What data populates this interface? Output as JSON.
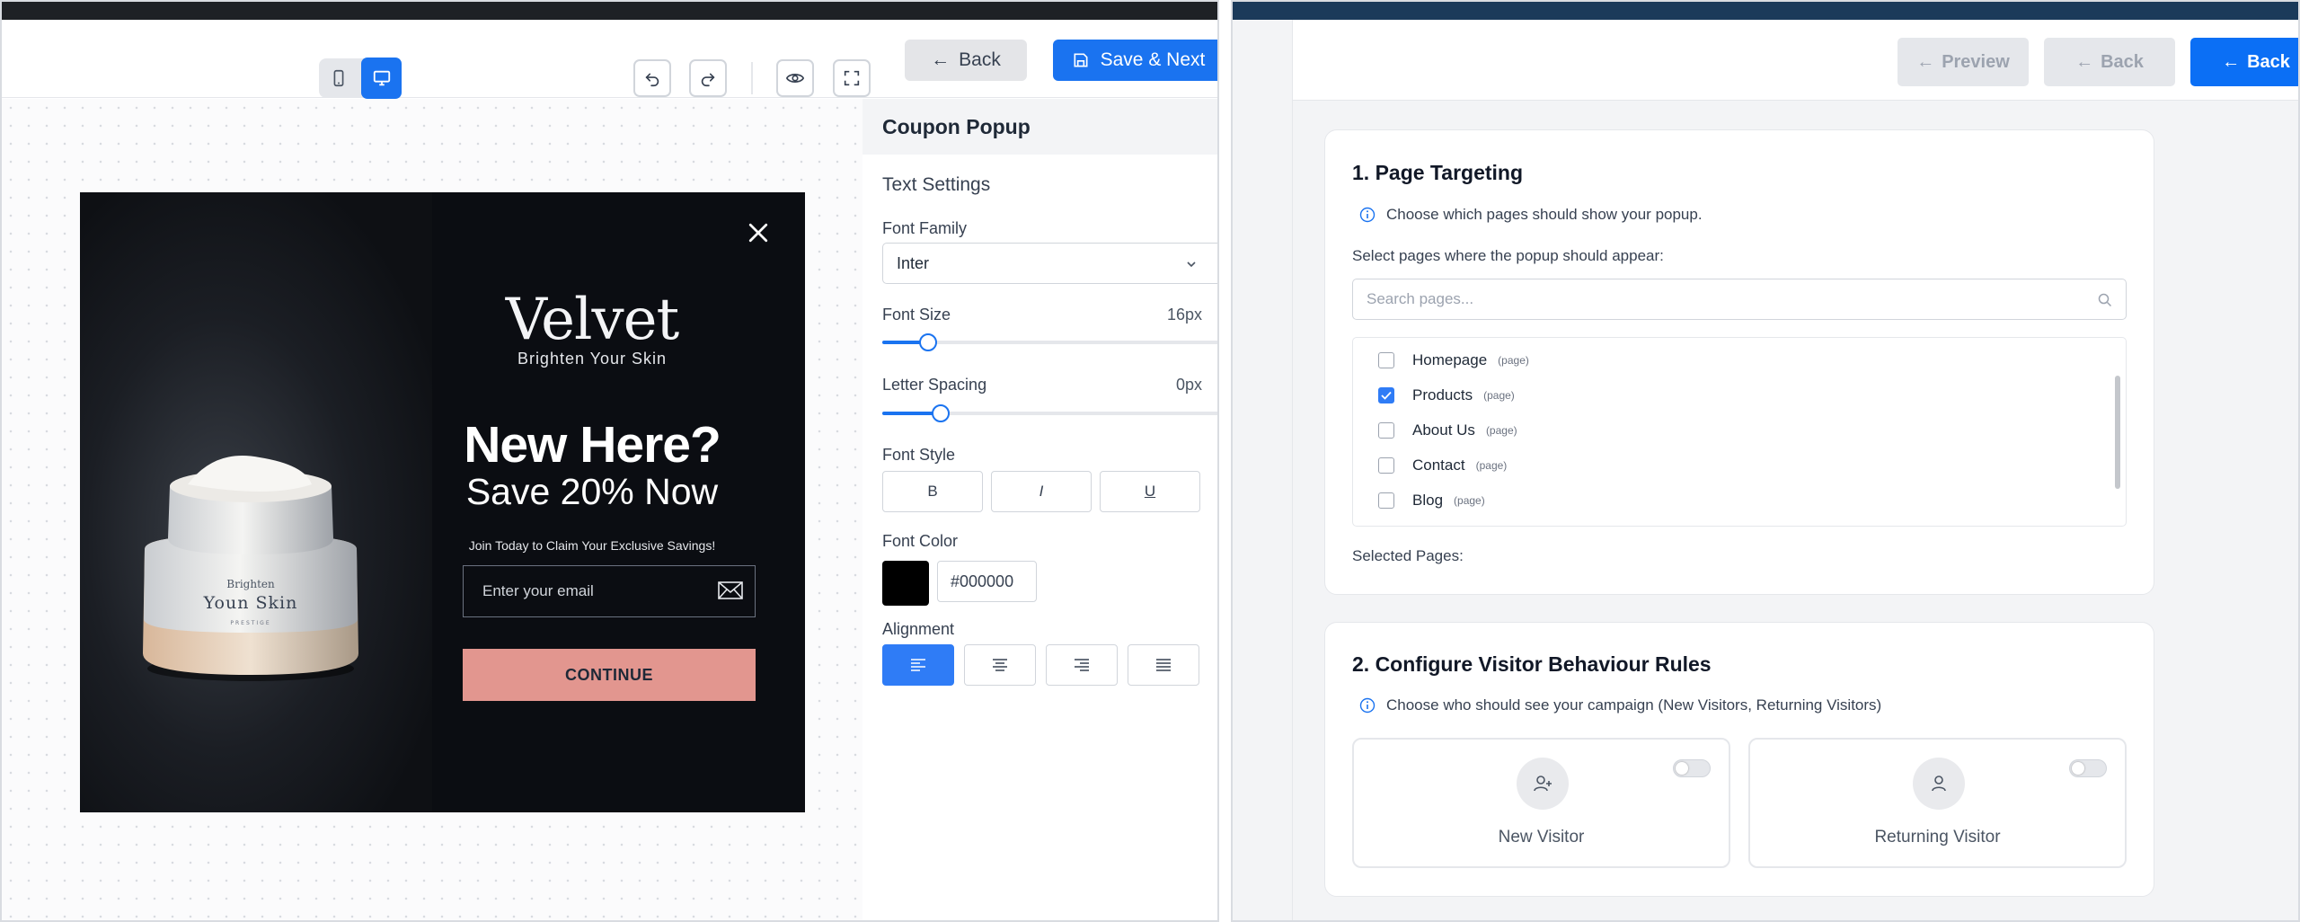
{
  "editor": {
    "toolbar": {
      "back_label": "Back",
      "save_next_label": "Save & Next"
    },
    "popup": {
      "brand": "Velvet",
      "tagline": "Brighten Your Skin",
      "headline": "New Here?",
      "subheadline": "Save 20% Now",
      "claim_text": "Join Today to Claim Your Exclusive Savings!",
      "email_placeholder": "Enter your email",
      "cta_label": "CONTINUE",
      "jar_label_line1": "Brighten",
      "jar_label_line2": "Youn Skin",
      "jar_label_line3": "PRESTIGE"
    },
    "sidebar": {
      "title": "Coupon Popup",
      "section": "Text Settings",
      "font_family_label": "Font Family",
      "font_family_value": "Inter",
      "font_size_label": "Font Size",
      "font_size_value": "16px",
      "letter_spacing_label": "Letter Spacing",
      "letter_spacing_value": "0px",
      "font_style_label": "Font Style",
      "font_style_options": [
        "B",
        "I",
        "U"
      ],
      "font_color_label": "Font Color",
      "font_color_value": "#000000",
      "alignment_label": "Alignment",
      "alignment_selected": "left"
    },
    "colors": {
      "accent": "#1a73f0",
      "cta": "#e2968f",
      "popup_bg": "#0b0d12"
    }
  },
  "targeting": {
    "header": {
      "preview_label": "Preview",
      "back_label": "Back",
      "back_primary_label": "Back"
    },
    "page_targeting": {
      "title": "1. Page Targeting",
      "info": "Choose which pages should show your popup.",
      "select_label": "Select pages where the popup should appear:",
      "search_placeholder": "Search pages...",
      "pages": [
        {
          "name": "Homepage",
          "tag": "(page)",
          "checked": false
        },
        {
          "name": "Products",
          "tag": "(page)",
          "checked": true
        },
        {
          "name": "About Us",
          "tag": "(page)",
          "checked": false
        },
        {
          "name": "Contact",
          "tag": "(page)",
          "checked": false
        },
        {
          "name": "Blog",
          "tag": "(page)",
          "checked": false
        }
      ],
      "selected_label": "Selected Pages:"
    },
    "visitor_rules": {
      "title": "2. Configure Visitor Behaviour Rules",
      "info": "Choose who should see your campaign (New Visitors, Returning Visitors)",
      "options": [
        {
          "label": "New Visitor",
          "enabled": false
        },
        {
          "label": "Returning Visitor",
          "enabled": false
        }
      ]
    }
  }
}
